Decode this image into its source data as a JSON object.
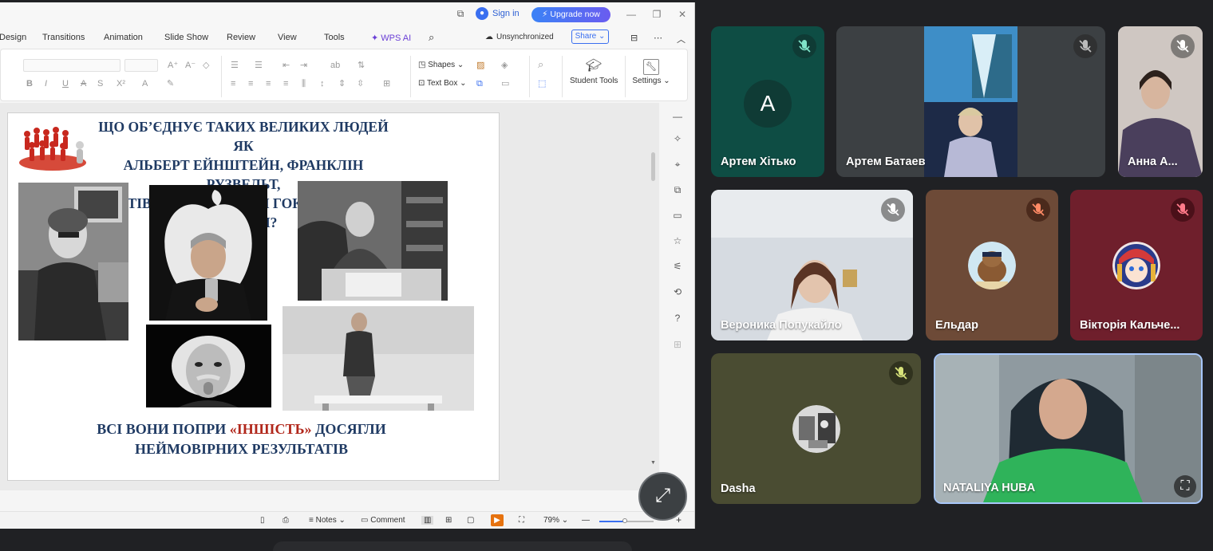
{
  "wps": {
    "titlebar": {
      "signin": "Sign in",
      "upgrade": "Upgrade now"
    },
    "tabs": [
      "Design",
      "Transitions",
      "Animation",
      "Slide Show",
      "Review",
      "View",
      "Tools",
      "WPS AI"
    ],
    "unsync": "Unsynchronized",
    "share": "Share",
    "ribbon": {
      "shapes": "Shapes",
      "textbox": "Text Box",
      "student_tools": "Student Tools",
      "settings": "Settings"
    },
    "slide": {
      "title_lines": [
        "ЩО ОБ’ЄДНУЄ ТАКИХ ВЕЛИКИХ ЛЮДЕЙ ЯК",
        "АЛЬБЕРТ ЕЙНШТЕЙН, ФРАНКЛІН РУЗВЕЛЬТ,",
        "СТІВ ДЖОБС, СТІВЕН ГОККІНГ, НІК ВУЙЧИЧ?"
      ],
      "foot_pre": "ВСІ ВОНИ ПОПРИ ",
      "foot_red": "«ІНШІСТЬ»",
      "foot_post": " ДОСЯГЛИ",
      "foot_line2": "НЕЙМОВІРНИХ РЕЗУЛЬТАТІВ"
    },
    "status": {
      "notes": "Notes",
      "comment": "Comment",
      "zoom": "79%"
    }
  },
  "participants": [
    {
      "name": "Артем Хітько",
      "initial": "A"
    },
    {
      "name": "Артем Батаев"
    },
    {
      "name": "Анна А..."
    },
    {
      "name": "Вероника Попукайло"
    },
    {
      "name": "Ельдар"
    },
    {
      "name": "Вікторія Кальче..."
    },
    {
      "name": "Dasha"
    },
    {
      "name": "NATALIYA HUBA"
    }
  ]
}
